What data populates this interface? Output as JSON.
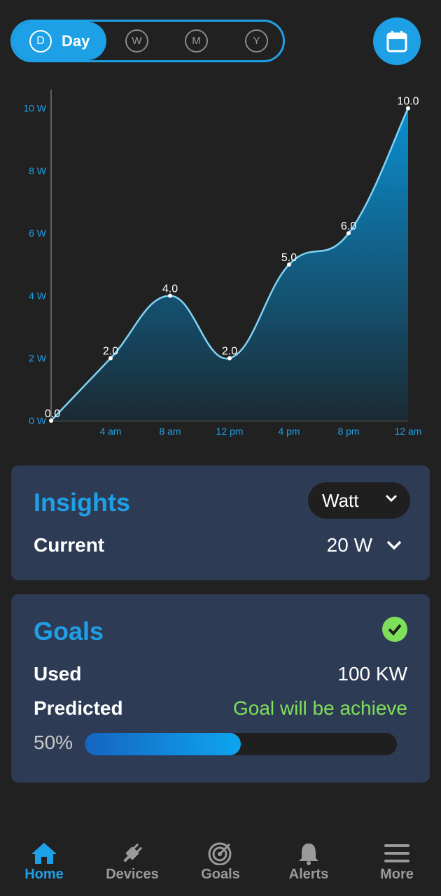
{
  "period_selector": {
    "active_icon_letter": "D",
    "active_label": "Day",
    "options": [
      "W",
      "M",
      "Y"
    ]
  },
  "calendar_button": {
    "icon": "calendar-icon"
  },
  "chart_data": {
    "type": "area",
    "categories": [
      "",
      "4 am",
      "8 am",
      "12 pm",
      "4 pm",
      "8 pm",
      "12 am"
    ],
    "values": [
      0.0,
      2.0,
      4.0,
      2.0,
      5.0,
      6.0,
      10.0
    ],
    "data_labels": [
      "0.0",
      "2.0",
      "4.0",
      "2.0",
      "5.0",
      "6.0",
      "10.0"
    ],
    "y_ticks": [
      "0 W",
      "2 W",
      "4 W",
      "6 W",
      "8 W",
      "10 W"
    ],
    "ylim": [
      0,
      11
    ],
    "line_color": "#7fd3f7",
    "fill_top_color": "#0a8fd1",
    "fill_bottom_color": "#1b2a33",
    "grid": false
  },
  "insights": {
    "title": "Insights",
    "unit_select": "Watt",
    "current_label": "Current",
    "current_value": "20 W"
  },
  "goals": {
    "title": "Goals",
    "used_label": "Used",
    "used_value": "100 KW",
    "predicted_label": "Predicted",
    "predicted_value": "Goal will be achieve",
    "predicted_color": "#7ee05a",
    "progress_label": "50%",
    "progress_fraction": 0.5
  },
  "nav": {
    "items": [
      {
        "label": "Home",
        "icon": "home-icon",
        "active": true
      },
      {
        "label": "Devices",
        "icon": "plug-icon",
        "active": false
      },
      {
        "label": "Goals",
        "icon": "target-icon",
        "active": false
      },
      {
        "label": "Alerts",
        "icon": "bell-icon",
        "active": false
      },
      {
        "label": "More",
        "icon": "menu-icon",
        "active": false
      }
    ]
  },
  "colors": {
    "accent": "#1ea0e6",
    "background": "#212121",
    "card": "#2e3b55"
  }
}
